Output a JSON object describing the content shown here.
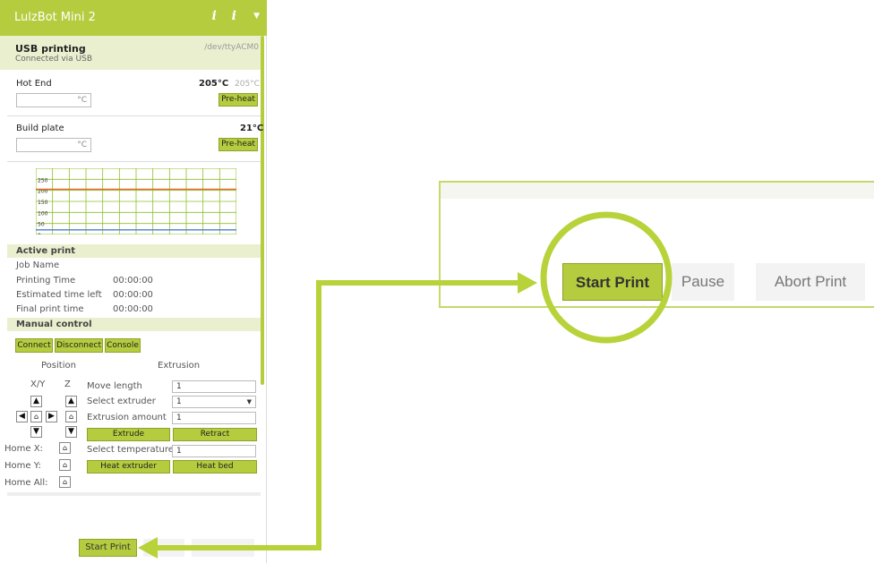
{
  "panel": {
    "title": "LulzBot Mini 2",
    "info_icons": "i  i",
    "usb_title": "USB printing",
    "usb_subtitle": "Connected via USB",
    "usb_device": "/dev/ttyACM0",
    "hot_end": {
      "label": "Hot End",
      "current": "205°C",
      "target": "205°C",
      "unit": "°C",
      "button": "Pre-heat"
    },
    "build_plate": {
      "label": "Build plate",
      "current": "21°C",
      "unit": "°C",
      "button": "Pre-heat"
    }
  },
  "chart_data": {
    "type": "line",
    "y_ticks": [
      "250",
      "200",
      "150",
      "100",
      "50",
      "0"
    ],
    "ylim": [
      0,
      300
    ],
    "grid": true,
    "series": [
      {
        "values": [
          205,
          205,
          205,
          205,
          205,
          205,
          205,
          205,
          205,
          205,
          205,
          205,
          205,
          205
        ],
        "color": "#e8642c"
      },
      {
        "values": [
          21,
          21,
          21,
          21,
          21,
          21,
          21,
          21,
          21,
          21,
          21,
          21,
          21,
          21
        ],
        "color": "#4a7fd4"
      }
    ]
  },
  "active_print": {
    "heading": "Active print",
    "job_name_label": "Job Name",
    "rows": [
      {
        "label": "Printing Time",
        "value": "00:00:00"
      },
      {
        "label": "Estimated time left",
        "value": "00:00:00"
      },
      {
        "label": "Final print time",
        "value": "00:00:00"
      }
    ]
  },
  "manual": {
    "heading": "Manual control",
    "tabs": [
      "Connect",
      "Disconnect",
      "Console"
    ],
    "position_label": "Position",
    "extrusion_label": "Extrusion",
    "xy_label": "X/Y",
    "z_label": "Z",
    "move_length_label": "Move length",
    "move_length_value": "1",
    "select_extruder_label": "Select extruder",
    "select_extruder_value": "1",
    "extrusion_amount_label": "Extrusion amount",
    "extrusion_amount_value": "1",
    "extrude_button": "Extrude",
    "retract_button": "Retract",
    "select_temp_label": "Select temperature",
    "select_temp_value": "1",
    "heat_extruder_button": "Heat extruder",
    "heat_bed_button": "Heat bed",
    "home_x_label": "Home X:",
    "home_y_label": "Home Y:",
    "home_all_label": "Home All:"
  },
  "bottom": {
    "start_print": "Start Print"
  },
  "zoom": {
    "start_print": "Start Print",
    "pause": "Pause",
    "abort_print": "Abort Print"
  },
  "colors": {
    "accent": "#b5cc3e",
    "callout": "#c5d86d",
    "arrow": "#b8d23a"
  }
}
